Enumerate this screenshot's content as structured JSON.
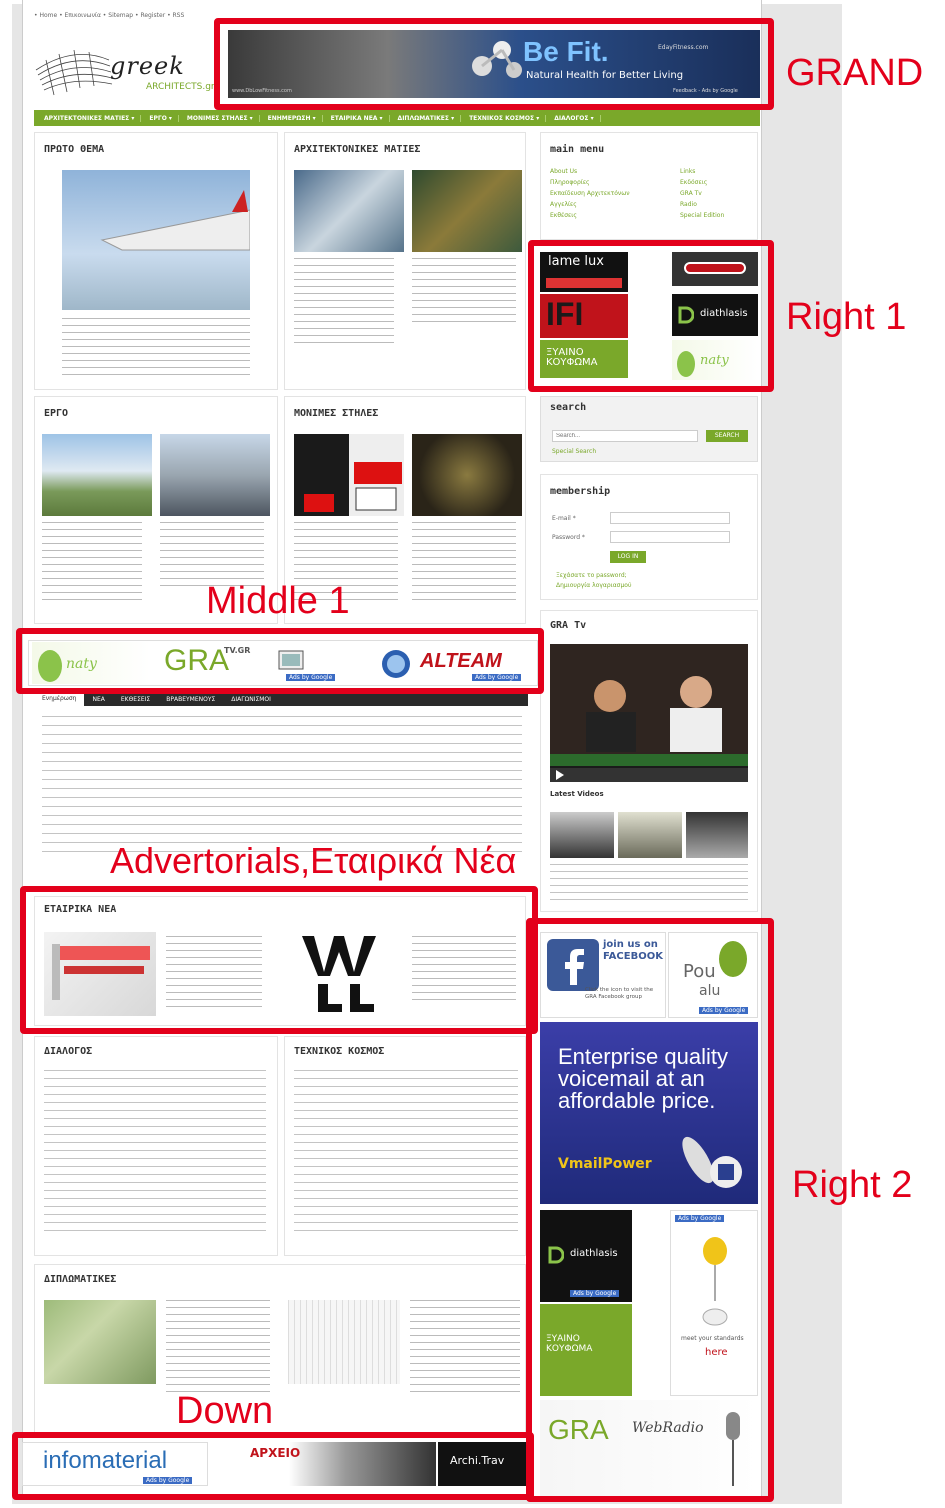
{
  "topnav": "• Home • Επικοινωνία • Sitemap • Register • RSS",
  "logo": {
    "word": "greek",
    "sub": "ARCHITECTS.gr"
  },
  "banner": {
    "headline": "Be Fit.",
    "tagline": "Natural Health for Better Living",
    "url": "EdayFitness.com",
    "ads": "Feedback - Ads by Google",
    "foot": "www.DbLowFitness.com"
  },
  "nav": [
    "ΑΡΧΙΤΕΚΤΟΝΙΚΕΣ ΜΑΤΙΕΣ ▾",
    "ΕΡΓΟ ▾",
    "ΜΟΝΙΜΕΣ ΣΤΗΛΕΣ ▾",
    "ΕΝΗΜΕΡΩΣΗ ▾",
    "ΕΤΑΙΡΙΚΑ ΝΕΑ ▾",
    "ΔΙΠΛΩΜΑΤΙΚΕΣ ▾",
    "ΤΕΧΝΙΚΟΣ ΚΟΣΜΟΣ ▾",
    "ΔΙΑΛΟΓΟΣ ▾"
  ],
  "sections": {
    "proto": "ΠΡΩΤΟ ΘΕΜΑ",
    "maties": "ΑΡΧΙΤΕΚΤΟΝΙΚΕΣ ΜΑΤΙΕΣ",
    "ergo": "ΕΡΓΟ",
    "monimes": "ΜΟΝΙΜΕΣ ΣΤΗΛΕΣ",
    "etairika": "ΕΤΑΙΡΙΚΑ ΝΕΑ",
    "dialogos": "ΔΙΑΛΟΓΟΣ",
    "texnikos": "ΤΕΧΝΙΚΟΣ ΚΟΣΜΟΣ",
    "diplomatikes": "ΔΙΠΛΩΜΑΤΙΚΕΣ"
  },
  "sidebar": {
    "menu_title": "main menu",
    "menu_left": [
      "About Us",
      "Πληροφορίες",
      "Εκπαίδευση Αρχιτεκτόνων",
      "Αγγελίες",
      "Εκθέσεις"
    ],
    "menu_right": [
      "Links",
      "Εκδόσεις",
      "GRA Tv",
      "Radio",
      "Special Edition"
    ],
    "search_title": "search",
    "search_placeholder": "Search...",
    "search_button": "SEARCH",
    "search_link": "Special Search",
    "membership_title": "membership",
    "email_label": "E-mail *",
    "password_label": "Password *",
    "login": "LOG IN",
    "forgot": "Ξεχάσατε το password;",
    "register": "Δημιουργία λογαριασμού",
    "tv_title": "GRA Tv",
    "latest_videos": "Latest Videos"
  },
  "tabs": [
    "Ενημέρωση",
    "ΝΕΑ",
    "ΕΚΘΕΣΕΙΣ",
    "ΒΡΑΒΕΥΜΕΝΟΥΣ",
    "ΔΙΑΓΩΝΙΣΜΟΙ"
  ],
  "ads": {
    "middle_alteam": "ALTEAM",
    "middle_gra": "GRA",
    "middle_gra_tv": "TV.GR",
    "adsgoogle": "Ads by Google",
    "right1_lamelux": "lame lux",
    "right1_ifi": "IFI",
    "right1_diathlasis": "diathlasis",
    "right1_xyaino": "ΞΥΑΙΝΟ ΚΟΥΦΩΜΑ",
    "right2_join": "join us on FACEBOOK",
    "right2_fb_click": "Click the icon to visit the GRA Facebook group",
    "right2_enterprise": "Enterprise quality voicemail at an affordable price.",
    "right2_vmail": "VmailPower",
    "right2_here": "here",
    "right2_standards": "meet your standards",
    "right2_webradio": "WebRadio",
    "right2_pou": "Pou",
    "right2_pou2": "alu",
    "down_info": "infomaterial",
    "down_archi": "Archi.Trav",
    "down_arxeio": "ΑΡΧΕΙΟ"
  },
  "labels": {
    "grand": "GRAND",
    "right1": "Right 1",
    "middle1": "Middle 1",
    "adverts": "Advertorials,Εταιρικά Νέα",
    "right2": "Right 2",
    "down": "Down"
  }
}
